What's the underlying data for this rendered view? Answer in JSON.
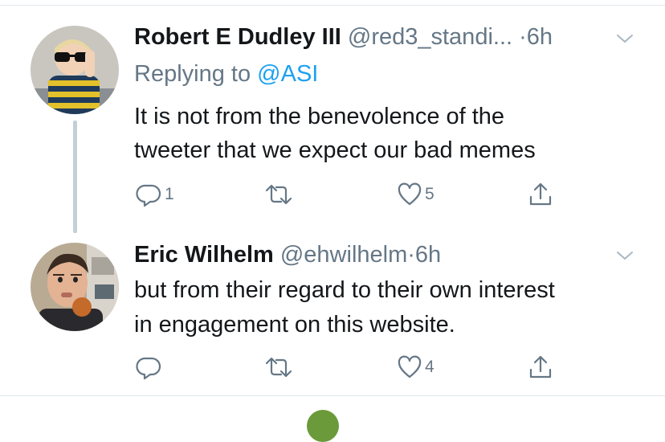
{
  "tweets": [
    {
      "name": "Robert E Dudley III",
      "handle": "@red3_standi...",
      "separator": " ·",
      "time": "6h",
      "replying_prefix": "Replying to ",
      "replying_to": "@ASI",
      "text_lines": [
        "It is not from the benevolence of the",
        "tweeter that we expect our bad memes"
      ],
      "reply_count": "1",
      "retweet_count": "",
      "like_count": "5"
    },
    {
      "name": "Eric Wilhelm",
      "handle": "@ehwilhelm",
      "separator": "·",
      "time": "6h",
      "text_lines": [
        "but from their regard to their own interest",
        "in engagement on this website."
      ],
      "reply_count": "",
      "retweet_count": "",
      "like_count": "4"
    }
  ],
  "icons": {
    "reply": "reply-icon",
    "retweet": "retweet-icon",
    "like": "heart-icon",
    "share": "share-icon",
    "caret": "chevron-down-icon"
  },
  "colors": {
    "text": "#14171a",
    "secondary": "#657786",
    "link": "#1da1f2",
    "thread_line": "#c4cfd6",
    "divider": "#e1e8ed"
  }
}
